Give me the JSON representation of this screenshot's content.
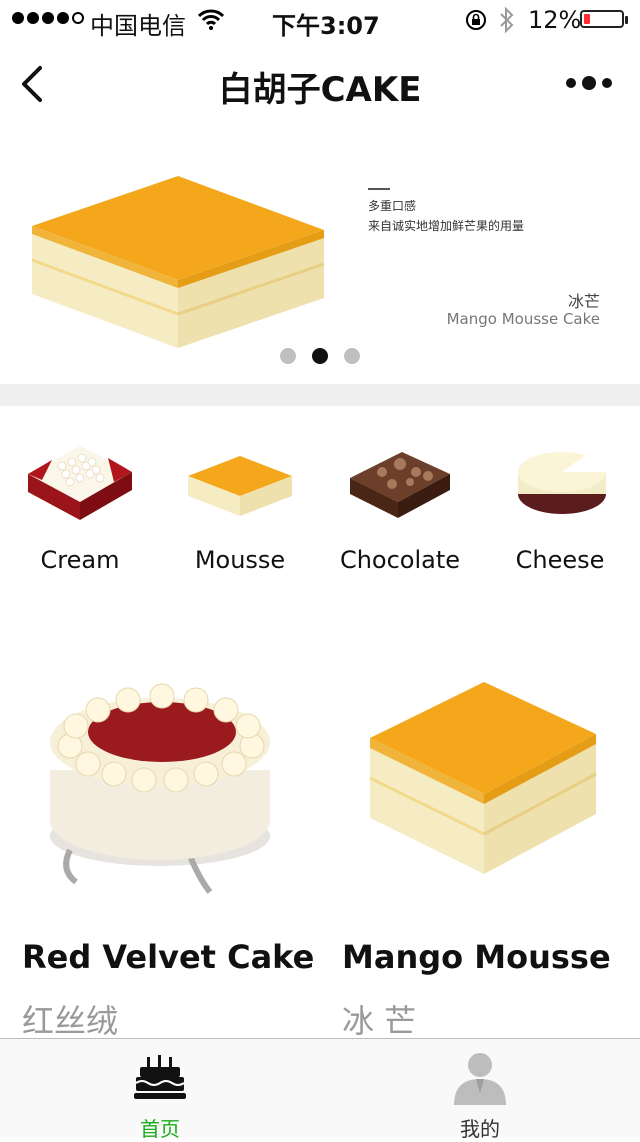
{
  "status_bar": {
    "carrier": "中国电信",
    "time": "下午3:07",
    "battery": "12%"
  },
  "nav": {
    "title": "白胡子CAKE"
  },
  "banner": {
    "tagline_line1": "多重口感",
    "tagline_line2": "来自诚实地增加鲜芒果的用量",
    "name_cn": "冰芒",
    "name_en": "Mango Mousse Cake",
    "pages": 3,
    "active_page": 2
  },
  "categories": [
    {
      "label": "Cream",
      "icon": "cream-cake-icon"
    },
    {
      "label": "Mousse",
      "icon": "mousse-cake-icon"
    },
    {
      "label": "Chocolate",
      "icon": "chocolate-cake-icon"
    },
    {
      "label": "Cheese",
      "icon": "cheese-cake-icon"
    }
  ],
  "products": [
    {
      "title": "Red Velvet Cake",
      "subtitle": "红丝绒"
    },
    {
      "title": "Mango Mousse",
      "subtitle": "冰 芒"
    }
  ],
  "tabbar": {
    "home_label": "首页",
    "mine_label": "我的",
    "active_color": "#1aad19",
    "inactive_color": "#333333"
  }
}
